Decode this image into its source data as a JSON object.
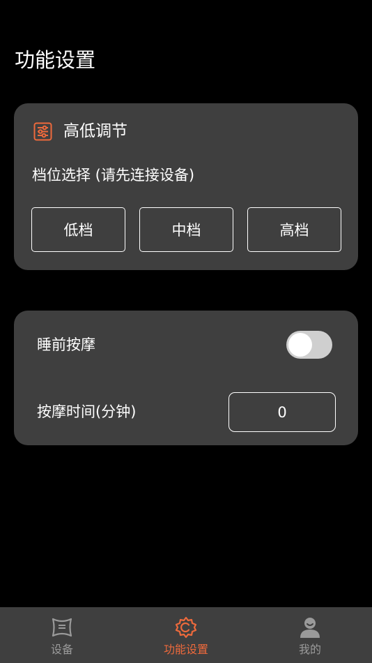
{
  "header": {
    "title": "功能设置"
  },
  "height_card": {
    "title": "高低调节",
    "gear_label": "档位选择 (请先连接设备)",
    "buttons": [
      "低档",
      "中档",
      "高档"
    ]
  },
  "massage_card": {
    "pre_sleep_label": "睡前按摩",
    "pre_sleep_enabled": false,
    "time_label": "按摩时间(分钟)",
    "time_value": "0"
  },
  "tabbar": {
    "items": [
      {
        "label": "设备",
        "icon": "device-icon",
        "active": false
      },
      {
        "label": "功能设置",
        "icon": "settings-gear-icon",
        "active": true
      },
      {
        "label": "我的",
        "icon": "profile-icon",
        "active": false
      }
    ]
  },
  "colors": {
    "accent": "#ee6a3c",
    "card": "#3f3f3f",
    "background": "#000000",
    "inactive": "#9a9a9a"
  }
}
